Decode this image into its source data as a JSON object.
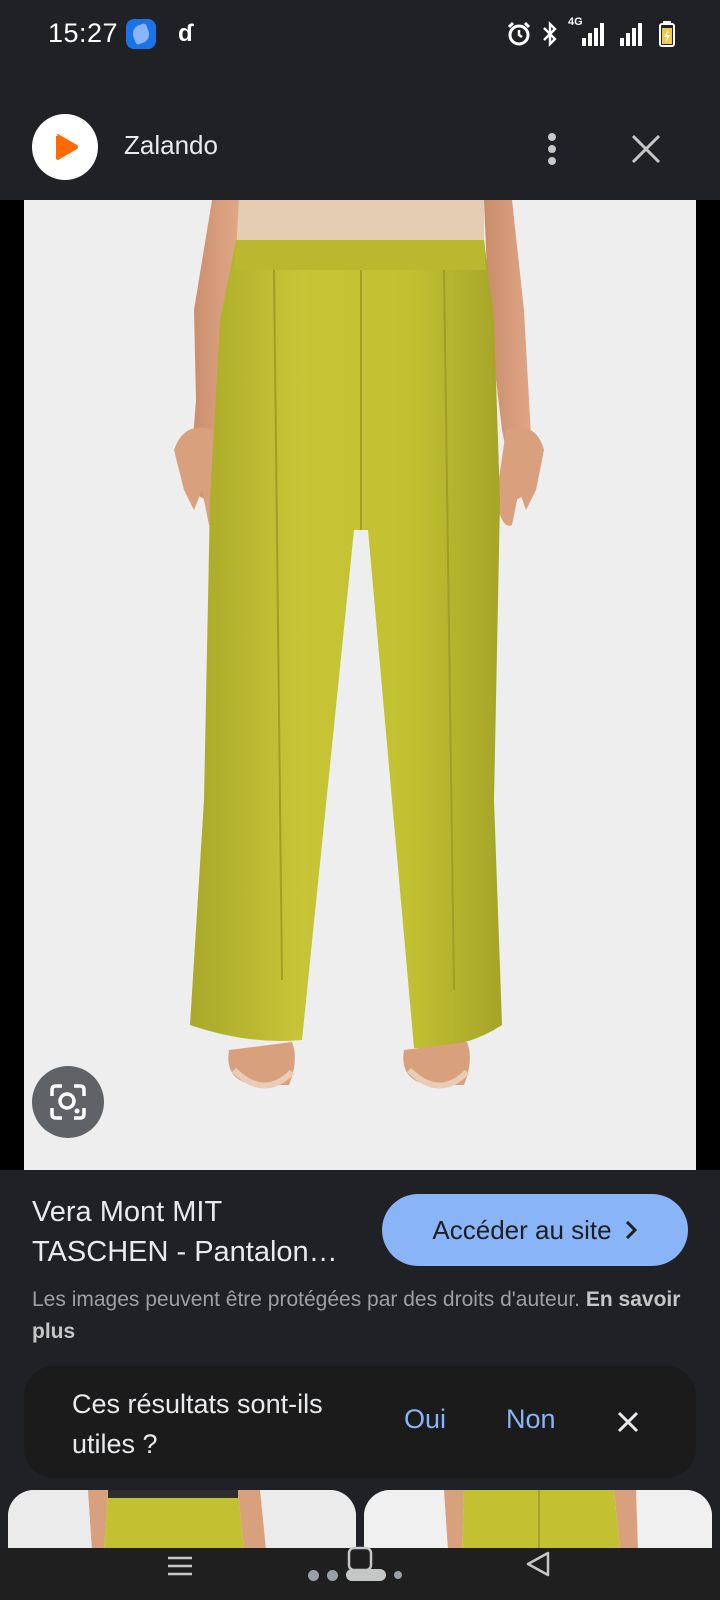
{
  "status_bar": {
    "time": "15:27",
    "network_label": "4G",
    "icons": [
      "blue-app-icon",
      "d-app-icon",
      "alarm-icon",
      "bluetooth-icon",
      "signal-icon",
      "signal-icon",
      "battery-icon"
    ]
  },
  "header": {
    "app_title": "Zalando",
    "logo_icon": "zalando-play-logo",
    "brand_color": "#ff6900"
  },
  "product": {
    "title": "Vera Mont MIT TASCHEN - Pantalon…",
    "visit_button_label": "Accéder au site",
    "copyright_text": "Les images peuvent être protégées par des droits d'auteur.",
    "learn_more_label": "En savoir plus",
    "trouser_color": "#c2c132"
  },
  "feedback": {
    "question": "Ces résultats sont-ils utiles ?",
    "yes_label": "Oui",
    "no_label": "Non"
  },
  "colors": {
    "background": "#202124",
    "accent": "#8ab4f8",
    "secondary_text": "#9aa0a6"
  }
}
